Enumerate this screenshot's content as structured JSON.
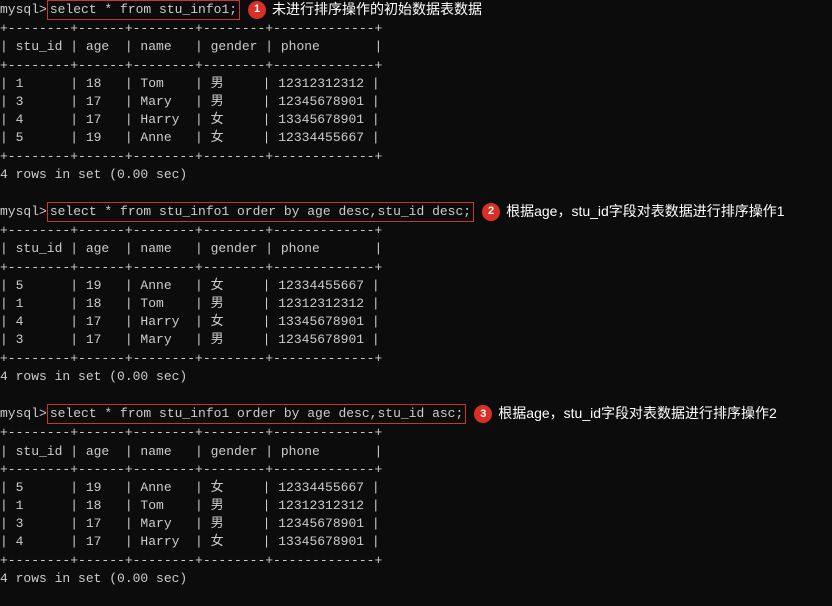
{
  "prompt": "mysql>",
  "queries": [
    {
      "sql": "select * from stu_info1;",
      "badge": "1",
      "annotation": "未进行排序操作的初始数据表数据",
      "headers": [
        "stu_id",
        "age",
        "name",
        "gender",
        "phone"
      ],
      "rows": [
        {
          "stu_id": "1",
          "age": "18",
          "name": "Tom",
          "gender": "男",
          "phone": "12312312312"
        },
        {
          "stu_id": "3",
          "age": "17",
          "name": "Mary",
          "gender": "男",
          "phone": "12345678901"
        },
        {
          "stu_id": "4",
          "age": "17",
          "name": "Harry",
          "gender": "女",
          "phone": "13345678901"
        },
        {
          "stu_id": "5",
          "age": "19",
          "name": "Anne",
          "gender": "女",
          "phone": "12334455667"
        }
      ],
      "footer": "4 rows in set (0.00 sec)"
    },
    {
      "sql": "select * from stu_info1 order by age desc,stu_id desc;",
      "badge": "2",
      "annotation": "根据age，stu_id字段对表数据进行排序操作1",
      "headers": [
        "stu_id",
        "age",
        "name",
        "gender",
        "phone"
      ],
      "rows": [
        {
          "stu_id": "5",
          "age": "19",
          "name": "Anne",
          "gender": "女",
          "phone": "12334455667"
        },
        {
          "stu_id": "1",
          "age": "18",
          "name": "Tom",
          "gender": "男",
          "phone": "12312312312"
        },
        {
          "stu_id": "4",
          "age": "17",
          "name": "Harry",
          "gender": "女",
          "phone": "13345678901"
        },
        {
          "stu_id": "3",
          "age": "17",
          "name": "Mary",
          "gender": "男",
          "phone": "12345678901"
        }
      ],
      "footer": "4 rows in set (0.00 sec)"
    },
    {
      "sql": "select * from stu_info1 order by age desc,stu_id asc;",
      "badge": "3",
      "annotation": "根据age，stu_id字段对表数据进行排序操作2",
      "headers": [
        "stu_id",
        "age",
        "name",
        "gender",
        "phone"
      ],
      "rows": [
        {
          "stu_id": "5",
          "age": "19",
          "name": "Anne",
          "gender": "女",
          "phone": "12334455667"
        },
        {
          "stu_id": "1",
          "age": "18",
          "name": "Tom",
          "gender": "男",
          "phone": "12312312312"
        },
        {
          "stu_id": "3",
          "age": "17",
          "name": "Mary",
          "gender": "男",
          "phone": "12345678901"
        },
        {
          "stu_id": "4",
          "age": "17",
          "name": "Harry",
          "gender": "女",
          "phone": "13345678901"
        }
      ],
      "footer": "4 rows in set (0.00 sec)"
    }
  ],
  "col_widths": {
    "stu_id": 8,
    "age": 6,
    "name": 8,
    "gender": 8,
    "phone": 13
  },
  "divider_char": "+",
  "dash_char": "-"
}
